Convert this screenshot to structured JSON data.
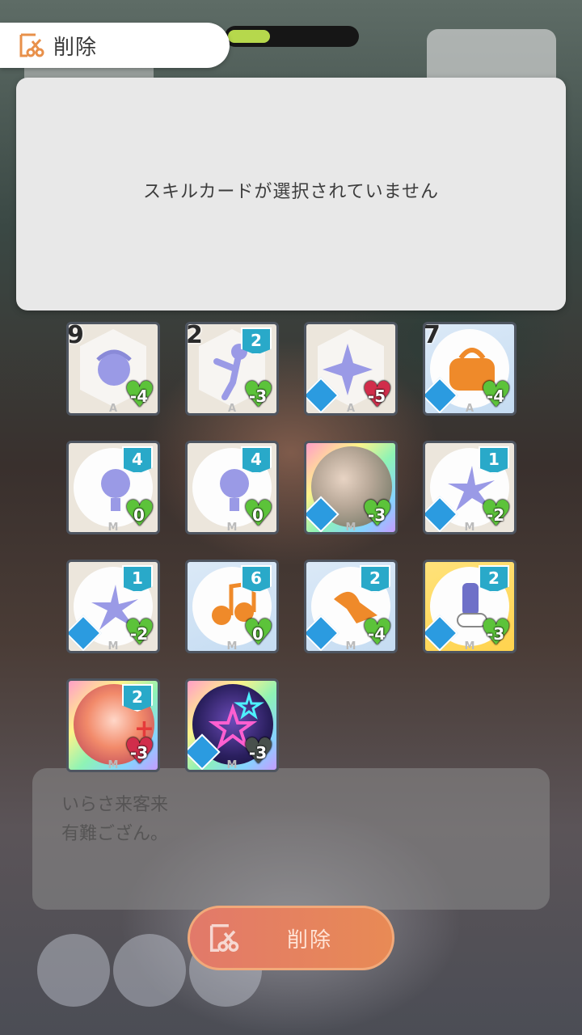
{
  "header": {
    "title": "削除",
    "icon": "scissors-icon"
  },
  "panel": {
    "empty_message": "スキルカードが選択されていません"
  },
  "cards": [
    {
      "stack": "9",
      "cost": "",
      "heart": "-4",
      "heart_color": "green",
      "frame": "plain",
      "art": "hand-swirl"
    },
    {
      "stack": "2",
      "cost": "2",
      "heart": "-3",
      "heart_color": "green",
      "frame": "plain",
      "art": "dancer"
    },
    {
      "stack": "",
      "cost": "",
      "heart": "-5",
      "heart_color": "red",
      "frame": "plain",
      "art": "sparkle"
    },
    {
      "stack": "7",
      "cost": "",
      "heart": "-4",
      "heart_color": "green",
      "frame": "blue",
      "art": "bag"
    },
    {
      "stack": "",
      "cost": "4",
      "heart": "0",
      "heart_color": "green",
      "frame": "plain",
      "art": "bulb"
    },
    {
      "stack": "",
      "cost": "4",
      "heart": "0",
      "heart_color": "green",
      "frame": "plain",
      "art": "bulb"
    },
    {
      "stack": "",
      "cost": "",
      "heart": "-3",
      "heart_color": "green",
      "frame": "rainbow",
      "art": "photo"
    },
    {
      "stack": "",
      "cost": "1",
      "heart": "-2",
      "heart_color": "green",
      "frame": "plain",
      "art": "splash"
    },
    {
      "stack": "",
      "cost": "1",
      "heart": "-2",
      "heart_color": "green",
      "frame": "plain",
      "art": "splash"
    },
    {
      "stack": "",
      "cost": "6",
      "heart": "0",
      "heart_color": "green",
      "frame": "blue",
      "art": "music"
    },
    {
      "stack": "",
      "cost": "2",
      "heart": "-4",
      "heart_color": "green",
      "frame": "blue",
      "art": "ribbon"
    },
    {
      "stack": "",
      "cost": "2",
      "heart": "-3",
      "heart_color": "green",
      "frame": "gold",
      "art": "shoe"
    },
    {
      "stack": "",
      "cost": "2",
      "heart": "-3",
      "heart_color": "red",
      "frame": "rainbow",
      "art": "idol"
    },
    {
      "stack": "",
      "cost": "",
      "heart": "-3",
      "heart_color": "dark",
      "frame": "rainbow",
      "art": "stars"
    }
  ],
  "card_rank_letters": [
    "A",
    "A",
    "A",
    "A",
    "M",
    "M",
    "M",
    "M",
    "M",
    "M",
    "M",
    "M",
    "M",
    "M"
  ],
  "bg_dialog": {
    "line1": "いらさ来客来",
    "line2": "有難ござん。"
  },
  "delete_button": {
    "label": "削除",
    "icon": "scissors-icon"
  },
  "colors": {
    "cost_badge": "#29a9c9",
    "heart_green": "#5cc33a",
    "heart_red": "#d12d4b",
    "button": "#e2796a"
  }
}
